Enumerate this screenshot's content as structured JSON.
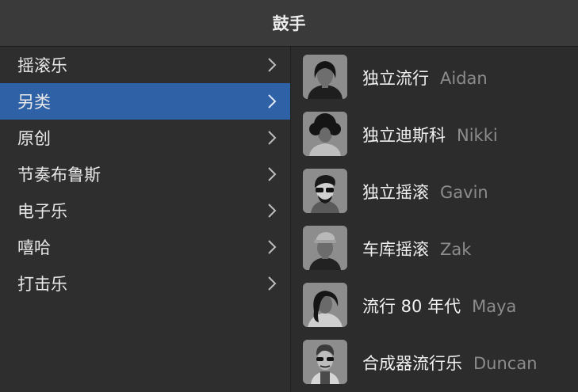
{
  "header": {
    "title": "鼓手"
  },
  "categories": [
    {
      "label": "摇滚乐",
      "selected": false
    },
    {
      "label": "另类",
      "selected": true
    },
    {
      "label": "原创",
      "selected": false
    },
    {
      "label": "节奏布鲁斯",
      "selected": false
    },
    {
      "label": "电子乐",
      "selected": false
    },
    {
      "label": "嘻哈",
      "selected": false
    },
    {
      "label": "打击乐",
      "selected": false
    }
  ],
  "drummers": [
    {
      "style": "独立流行",
      "name": "Aidan"
    },
    {
      "style": "独立迪斯科",
      "name": "Nikki"
    },
    {
      "style": "独立摇滚",
      "name": "Gavin"
    },
    {
      "style": "车库摇滚",
      "name": "Zak"
    },
    {
      "style": "流行 80 年代",
      "name": "Maya"
    },
    {
      "style": "合成器流行乐",
      "name": "Duncan"
    }
  ],
  "colors": {
    "selection": "#2f61a6",
    "header": "#3a3a3a",
    "secondary_text": "#8c8c8c"
  }
}
